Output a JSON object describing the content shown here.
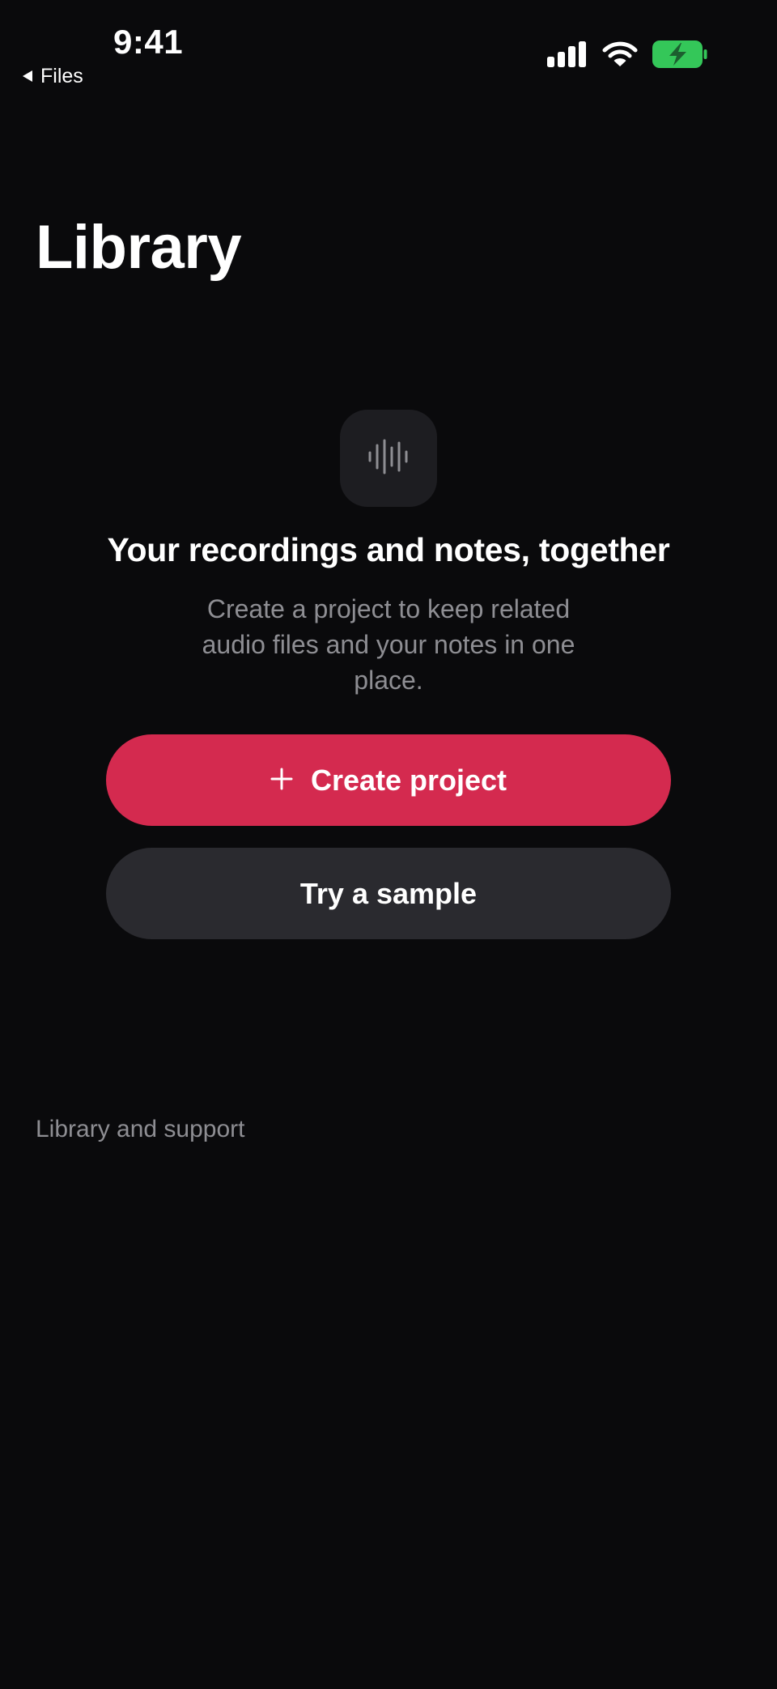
{
  "status_bar": {
    "time": "9:41",
    "back_label": "Files",
    "icons": [
      "cellular-signal-icon",
      "wifi-icon",
      "battery-charging-icon"
    ],
    "battery_color": "#34c759"
  },
  "header": {
    "title": "Library"
  },
  "empty_state": {
    "icon": "waveform-icon",
    "heading": "Your recordings and notes, together",
    "body": "Create a project to keep related audio files and your notes in one place."
  },
  "actions": {
    "create_icon": "plus-icon",
    "create_label": "Create project",
    "sample_label": "Try a sample"
  },
  "footer": {
    "link_label": "Library and support"
  },
  "colors": {
    "background": "#0a0a0c",
    "accent": "#d42a4f",
    "secondary_button": "#2a2a2f",
    "muted_text": "#8e8e93"
  }
}
